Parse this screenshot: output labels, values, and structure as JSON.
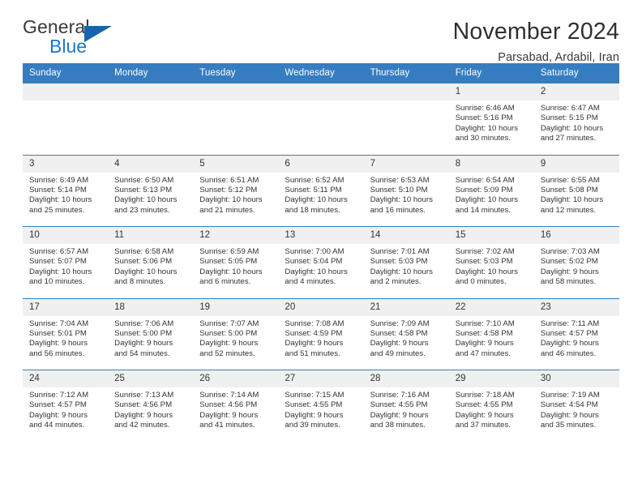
{
  "brand": {
    "name_part1": "General",
    "name_part2": "Blue",
    "accent_color": "#1b79c6",
    "triangle_color": "#1566ae"
  },
  "header": {
    "title": "November 2024",
    "subtitle": "Parsabad, Ardabil, Iran",
    "header_bg_color": "#357dc0",
    "header_text_color": "#ffffff"
  },
  "weekdays": [
    "Sunday",
    "Monday",
    "Tuesday",
    "Wednesday",
    "Thursday",
    "Friday",
    "Saturday"
  ],
  "weeks": [
    [
      {
        "day": "",
        "lines": []
      },
      {
        "day": "",
        "lines": []
      },
      {
        "day": "",
        "lines": []
      },
      {
        "day": "",
        "lines": []
      },
      {
        "day": "",
        "lines": []
      },
      {
        "day": "1",
        "lines": [
          "Sunrise: 6:46 AM",
          "Sunset: 5:16 PM",
          "Daylight: 10 hours and 30 minutes."
        ]
      },
      {
        "day": "2",
        "lines": [
          "Sunrise: 6:47 AM",
          "Sunset: 5:15 PM",
          "Daylight: 10 hours and 27 minutes."
        ]
      }
    ],
    [
      {
        "day": "3",
        "lines": [
          "Sunrise: 6:49 AM",
          "Sunset: 5:14 PM",
          "Daylight: 10 hours and 25 minutes."
        ]
      },
      {
        "day": "4",
        "lines": [
          "Sunrise: 6:50 AM",
          "Sunset: 5:13 PM",
          "Daylight: 10 hours and 23 minutes."
        ]
      },
      {
        "day": "5",
        "lines": [
          "Sunrise: 6:51 AM",
          "Sunset: 5:12 PM",
          "Daylight: 10 hours and 21 minutes."
        ]
      },
      {
        "day": "6",
        "lines": [
          "Sunrise: 6:52 AM",
          "Sunset: 5:11 PM",
          "Daylight: 10 hours and 18 minutes."
        ]
      },
      {
        "day": "7",
        "lines": [
          "Sunrise: 6:53 AM",
          "Sunset: 5:10 PM",
          "Daylight: 10 hours and 16 minutes."
        ]
      },
      {
        "day": "8",
        "lines": [
          "Sunrise: 6:54 AM",
          "Sunset: 5:09 PM",
          "Daylight: 10 hours and 14 minutes."
        ]
      },
      {
        "day": "9",
        "lines": [
          "Sunrise: 6:55 AM",
          "Sunset: 5:08 PM",
          "Daylight: 10 hours and 12 minutes."
        ]
      }
    ],
    [
      {
        "day": "10",
        "lines": [
          "Sunrise: 6:57 AM",
          "Sunset: 5:07 PM",
          "Daylight: 10 hours and 10 minutes."
        ]
      },
      {
        "day": "11",
        "lines": [
          "Sunrise: 6:58 AM",
          "Sunset: 5:06 PM",
          "Daylight: 10 hours and 8 minutes."
        ]
      },
      {
        "day": "12",
        "lines": [
          "Sunrise: 6:59 AM",
          "Sunset: 5:05 PM",
          "Daylight: 10 hours and 6 minutes."
        ]
      },
      {
        "day": "13",
        "lines": [
          "Sunrise: 7:00 AM",
          "Sunset: 5:04 PM",
          "Daylight: 10 hours and 4 minutes."
        ]
      },
      {
        "day": "14",
        "lines": [
          "Sunrise: 7:01 AM",
          "Sunset: 5:03 PM",
          "Daylight: 10 hours and 2 minutes."
        ]
      },
      {
        "day": "15",
        "lines": [
          "Sunrise: 7:02 AM",
          "Sunset: 5:03 PM",
          "Daylight: 10 hours and 0 minutes."
        ]
      },
      {
        "day": "16",
        "lines": [
          "Sunrise: 7:03 AM",
          "Sunset: 5:02 PM",
          "Daylight: 9 hours and 58 minutes."
        ]
      }
    ],
    [
      {
        "day": "17",
        "lines": [
          "Sunrise: 7:04 AM",
          "Sunset: 5:01 PM",
          "Daylight: 9 hours and 56 minutes."
        ]
      },
      {
        "day": "18",
        "lines": [
          "Sunrise: 7:06 AM",
          "Sunset: 5:00 PM",
          "Daylight: 9 hours and 54 minutes."
        ]
      },
      {
        "day": "19",
        "lines": [
          "Sunrise: 7:07 AM",
          "Sunset: 5:00 PM",
          "Daylight: 9 hours and 52 minutes."
        ]
      },
      {
        "day": "20",
        "lines": [
          "Sunrise: 7:08 AM",
          "Sunset: 4:59 PM",
          "Daylight: 9 hours and 51 minutes."
        ]
      },
      {
        "day": "21",
        "lines": [
          "Sunrise: 7:09 AM",
          "Sunset: 4:58 PM",
          "Daylight: 9 hours and 49 minutes."
        ]
      },
      {
        "day": "22",
        "lines": [
          "Sunrise: 7:10 AM",
          "Sunset: 4:58 PM",
          "Daylight: 9 hours and 47 minutes."
        ]
      },
      {
        "day": "23",
        "lines": [
          "Sunrise: 7:11 AM",
          "Sunset: 4:57 PM",
          "Daylight: 9 hours and 46 minutes."
        ]
      }
    ],
    [
      {
        "day": "24",
        "lines": [
          "Sunrise: 7:12 AM",
          "Sunset: 4:57 PM",
          "Daylight: 9 hours and 44 minutes."
        ]
      },
      {
        "day": "25",
        "lines": [
          "Sunrise: 7:13 AM",
          "Sunset: 4:56 PM",
          "Daylight: 9 hours and 42 minutes."
        ]
      },
      {
        "day": "26",
        "lines": [
          "Sunrise: 7:14 AM",
          "Sunset: 4:56 PM",
          "Daylight: 9 hours and 41 minutes."
        ]
      },
      {
        "day": "27",
        "lines": [
          "Sunrise: 7:15 AM",
          "Sunset: 4:55 PM",
          "Daylight: 9 hours and 39 minutes."
        ]
      },
      {
        "day": "28",
        "lines": [
          "Sunrise: 7:16 AM",
          "Sunset: 4:55 PM",
          "Daylight: 9 hours and 38 minutes."
        ]
      },
      {
        "day": "29",
        "lines": [
          "Sunrise: 7:18 AM",
          "Sunset: 4:55 PM",
          "Daylight: 9 hours and 37 minutes."
        ]
      },
      {
        "day": "30",
        "lines": [
          "Sunrise: 7:19 AM",
          "Sunset: 4:54 PM",
          "Daylight: 9 hours and 35 minutes."
        ]
      }
    ]
  ]
}
